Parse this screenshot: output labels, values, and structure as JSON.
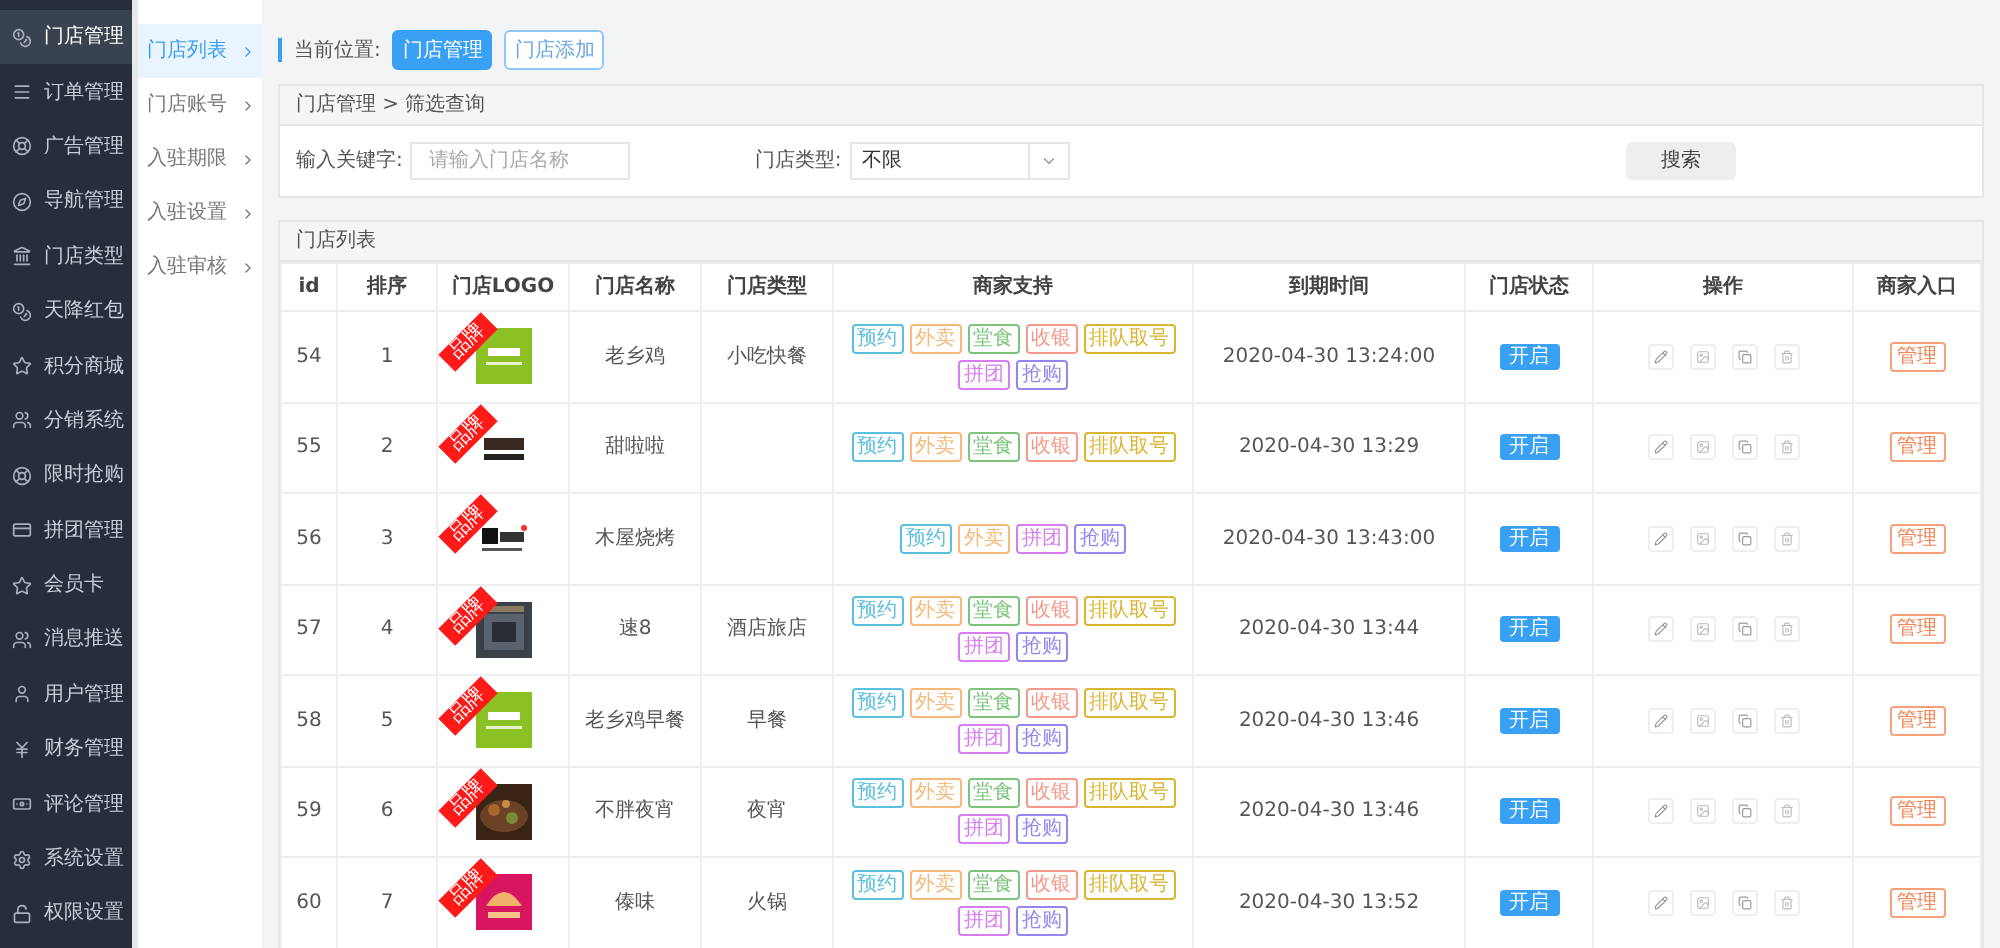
{
  "sidebar": {
    "items": [
      {
        "label": "门店管理",
        "selected": true
      },
      {
        "label": "订单管理",
        "selected": false
      },
      {
        "label": "广告管理",
        "selected": false
      },
      {
        "label": "导航管理",
        "selected": false
      },
      {
        "label": "门店类型",
        "selected": false
      },
      {
        "label": "天降红包",
        "selected": false
      },
      {
        "label": "积分商城",
        "selected": false
      },
      {
        "label": "分销系统",
        "selected": false
      },
      {
        "label": "限时抢购",
        "selected": false
      },
      {
        "label": "拼团管理",
        "selected": false
      },
      {
        "label": "会员卡",
        "selected": false
      },
      {
        "label": "消息推送",
        "selected": false
      },
      {
        "label": "用户管理",
        "selected": false
      },
      {
        "label": "财务管理",
        "selected": false
      },
      {
        "label": "评论管理",
        "selected": false
      },
      {
        "label": "系统设置",
        "selected": false
      },
      {
        "label": "权限设置",
        "selected": false
      }
    ]
  },
  "subnav": {
    "items": [
      {
        "label": "门店列表",
        "selected": true
      },
      {
        "label": "门店账号",
        "selected": false
      },
      {
        "label": "入驻期限",
        "selected": false
      },
      {
        "label": "入驻设置",
        "selected": false
      },
      {
        "label": "入驻审核",
        "selected": false
      }
    ]
  },
  "location": {
    "label": "当前位置:",
    "buttons": [
      {
        "label": "门店管理",
        "selected": true
      },
      {
        "label": "门店添加",
        "selected": false
      }
    ]
  },
  "filter": {
    "title": "门店管理 > 筛选查询",
    "keyword_label": "输入关键字:",
    "keyword_placeholder": "请输入门店名称",
    "type_label": "门店类型:",
    "type_value": "不限",
    "search_button": "搜索"
  },
  "table": {
    "title": "门店列表",
    "columns": [
      "id",
      "排序",
      "门店LOGO",
      "门店名称",
      "门店类型",
      "商家支持",
      "到期时间",
      "门店状态",
      "操作",
      "商家入口"
    ],
    "rows": [
      {
        "id": "54",
        "sort": "1",
        "badge": "品牌",
        "name": "老乡鸡",
        "type": "小吃快餐",
        "tags": [
          {
            "label": "预约",
            "color": "#5bc0de"
          },
          {
            "label": "外卖",
            "color": "#f5b97a"
          },
          {
            "label": "堂食",
            "color": "#7cc47c"
          },
          {
            "label": "收银",
            "color": "#f59a8a"
          },
          {
            "label": "排队取号",
            "color": "#d9b530"
          },
          {
            "label": "拼团",
            "color": "#d67ef0"
          },
          {
            "label": "抢购",
            "color": "#9486f2"
          }
        ],
        "expiry": "2020-04-30 13:24:00",
        "status": "开启",
        "entry": "管理"
      },
      {
        "id": "55",
        "sort": "2",
        "badge": "品牌",
        "name": "甜啦啦",
        "tags": [
          {
            "label": "预约",
            "color": "#5bc0de"
          },
          {
            "label": "外卖",
            "color": "#f5b97a"
          },
          {
            "label": "堂食",
            "color": "#7cc47c"
          },
          {
            "label": "收银",
            "color": "#f59a8a"
          },
          {
            "label": "排队取号",
            "color": "#d9b530"
          }
        ],
        "expiry": "2020-04-30 13:29",
        "status": "开启",
        "entry": "管理"
      },
      {
        "id": "56",
        "sort": "3",
        "badge": "品牌",
        "name": "木屋烧烤",
        "tags": [
          {
            "label": "预约",
            "color": "#5bc0de"
          },
          {
            "label": "外卖",
            "color": "#f5b97a"
          },
          {
            "label": "拼团",
            "color": "#d67ef0"
          },
          {
            "label": "抢购",
            "color": "#9486f2"
          }
        ],
        "expiry": "2020-04-30 13:43:00",
        "status": "开启",
        "entry": "管理"
      },
      {
        "id": "57",
        "sort": "4",
        "badge": "品牌",
        "name": "速8",
        "type": "酒店旅店",
        "tags": [
          {
            "label": "预约",
            "color": "#5bc0de"
          },
          {
            "label": "外卖",
            "color": "#f5b97a"
          },
          {
            "label": "堂食",
            "color": "#7cc47c"
          },
          {
            "label": "收银",
            "color": "#f59a8a"
          },
          {
            "label": "排队取号",
            "color": "#d9b530"
          },
          {
            "label": "拼团",
            "color": "#d67ef0"
          },
          {
            "label": "抢购",
            "color": "#9486f2"
          }
        ],
        "expiry": "2020-04-30 13:44",
        "status": "开启",
        "entry": "管理"
      },
      {
        "id": "58",
        "sort": "5",
        "badge": "品牌",
        "name": "老乡鸡早餐",
        "type": "早餐",
        "tags": [
          {
            "label": "预约",
            "color": "#5bc0de"
          },
          {
            "label": "外卖",
            "color": "#f5b97a"
          },
          {
            "label": "堂食",
            "color": "#7cc47c"
          },
          {
            "label": "收银",
            "color": "#f59a8a"
          },
          {
            "label": "排队取号",
            "color": "#d9b530"
          },
          {
            "label": "拼团",
            "color": "#d67ef0"
          },
          {
            "label": "抢购",
            "color": "#9486f2"
          }
        ],
        "expiry": "2020-04-30 13:46",
        "status": "开启",
        "entry": "管理"
      },
      {
        "id": "59",
        "sort": "6",
        "badge": "品牌",
        "name": "不胖夜宵",
        "type": "夜宵",
        "tags": [
          {
            "label": "预约",
            "color": "#5bc0de"
          },
          {
            "label": "外卖",
            "color": "#f5b97a"
          },
          {
            "label": "堂食",
            "color": "#7cc47c"
          },
          {
            "label": "收银",
            "color": "#f59a8a"
          },
          {
            "label": "排队取号",
            "color": "#d9b530"
          },
          {
            "label": "拼团",
            "color": "#d67ef0"
          },
          {
            "label": "抢购",
            "color": "#9486f2"
          }
        ],
        "expiry": "2020-04-30 13:46",
        "status": "开启",
        "entry": "管理"
      },
      {
        "id": "60",
        "sort": "7",
        "badge": "品牌",
        "name": "傣味",
        "type": "火锅",
        "tags": [
          {
            "label": "预约",
            "color": "#5bc0de"
          },
          {
            "label": "外卖",
            "color": "#f5b97a"
          },
          {
            "label": "堂食",
            "color": "#7cc47c"
          },
          {
            "label": "收银",
            "color": "#f59a8a"
          },
          {
            "label": "排队取号",
            "color": "#d9b530"
          },
          {
            "label": "拼团",
            "color": "#d67ef0"
          },
          {
            "label": "抢购",
            "color": "#9486f2"
          }
        ],
        "expiry": "2020-04-30 13:52",
        "status": "开启",
        "entry": "管理"
      }
    ]
  }
}
